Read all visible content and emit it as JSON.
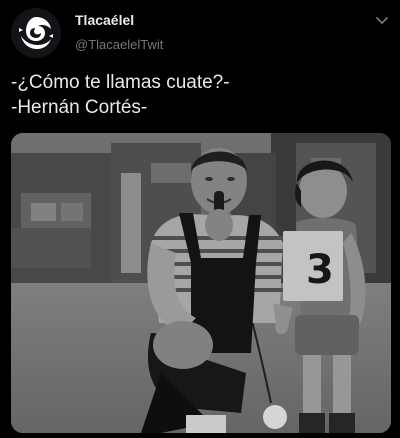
{
  "tweet": {
    "author": {
      "display_name": "Tlacaélel",
      "handle": "@TlacaelelTwit",
      "avatar_icon": "spiral-logo-icon"
    },
    "menu_icon": "chevron-down-icon",
    "text_lines": [
      "-¿Cómo te llamas cuate?-",
      "-Hernán Cortés-"
    ],
    "media": {
      "type": "photo",
      "description_icon": "black-and-white-photo",
      "bib_number": "3"
    }
  },
  "colors": {
    "background": "#000000",
    "primary_text": "#e7e9ea",
    "secondary_text": "#71767b"
  }
}
